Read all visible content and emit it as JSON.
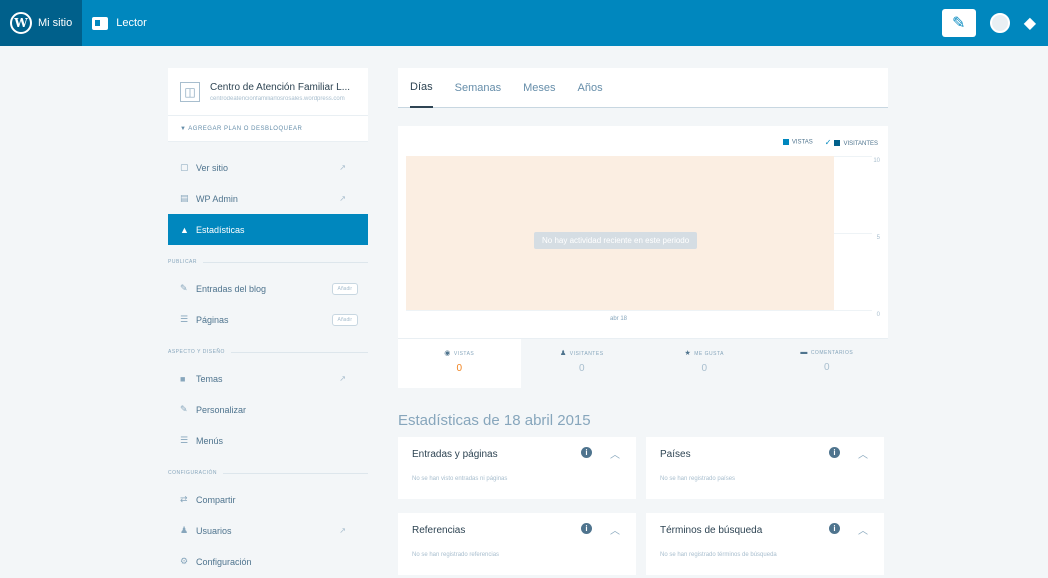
{
  "topbar": {
    "my_site_label": "Mi sitio",
    "reader_label": "Lector",
    "write_icon": "pencil-icon",
    "notifications_icon": "bell-icon"
  },
  "sidebar": {
    "site_name": "Centro de Atención Familiar L...",
    "site_url": "centrodeatencionfamiliarlosrosales.wordpress.com",
    "plan_label": "▼ AGREGAR PLAN O DESBLOQUEAR",
    "items_top": [
      {
        "label": "Ver sitio",
        "icon": "site-icon"
      },
      {
        "label": "WP Admin",
        "icon": "admin-icon"
      },
      {
        "label": "Estadísticas",
        "icon": "stats-icon"
      }
    ],
    "section_publish": "PUBLICAR",
    "items_publish": [
      {
        "label": "Entradas del blog",
        "button": "Añadir"
      },
      {
        "label": "Páginas",
        "button": "Añadir"
      }
    ],
    "section_design": "ASPECTO Y DISEÑO",
    "items_design": [
      {
        "label": "Temas"
      },
      {
        "label": "Personalizar"
      },
      {
        "label": "Menús"
      }
    ],
    "section_config": "CONFIGURACIÓN",
    "items_config": [
      {
        "label": "Compartir"
      },
      {
        "label": "Usuarios"
      },
      {
        "label": "Configuración"
      }
    ]
  },
  "main": {
    "tabs": [
      {
        "label": "Días",
        "active": true
      },
      {
        "label": "Semanas",
        "active": false
      },
      {
        "label": "Meses",
        "active": false
      },
      {
        "label": "Años",
        "active": false
      }
    ],
    "legend": {
      "views": "VISTAS",
      "visitors": "VISITANTES"
    },
    "empty_message": "No hay actividad reciente en este periodo",
    "x_tick": "abr 18",
    "stats": [
      {
        "label": "VISTAS",
        "value": "0",
        "active": true
      },
      {
        "label": "VISITANTES",
        "value": "0",
        "active": false
      },
      {
        "label": "ME GUSTA",
        "value": "0",
        "active": false
      },
      {
        "label": "COMENTARIOS",
        "value": "0",
        "active": false
      }
    ],
    "stats_date": "Estadísticas de 18 abril 2015",
    "modules": [
      {
        "title": "Entradas y páginas",
        "empty": "No se han visto entradas ni páginas"
      },
      {
        "title": "Países",
        "empty": "No se han registrado países"
      },
      {
        "title": "Referencias",
        "empty": "No se han registrado referencias"
      },
      {
        "title": "Términos de búsqueda",
        "empty": "No se han registrado términos de búsqueda"
      }
    ]
  },
  "colors": {
    "brand": "#0087be",
    "accent": "#f0821e",
    "chart_fill": "#fbeee2"
  },
  "chart_data": {
    "type": "bar",
    "categories": [
      "abr 18"
    ],
    "series": [
      {
        "name": "VISTAS",
        "values": [
          0
        ]
      },
      {
        "name": "VISITANTES",
        "values": [
          0
        ]
      }
    ],
    "ylim": [
      0,
      10
    ],
    "yticks": [
      "10",
      "5",
      "0"
    ]
  }
}
